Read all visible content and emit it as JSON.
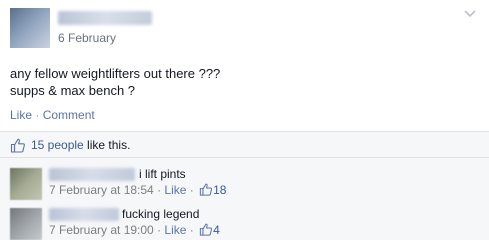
{
  "post": {
    "date": "6 February",
    "body_lines": [
      "any fellow weightlifters out there ???",
      "supps & max bench ?"
    ],
    "actions": {
      "like": "Like",
      "separator": "·",
      "comment": "Comment"
    }
  },
  "feedback": {
    "likes_count": "15 people",
    "likes_suffix": " like this."
  },
  "comments": [
    {
      "text": "i lift pints",
      "date": "7 February at 18:54",
      "separator": " · ",
      "like": "Like",
      "separator2": " · ",
      "likes": "18"
    },
    {
      "text": "fucking legend",
      "date": "7 February at 19:00",
      "separator": " · ",
      "like": "Like",
      "separator2": " · ",
      "likes": "4"
    }
  ],
  "icons": {
    "options": "chevron-down-icon",
    "like": "thumbs-up-icon"
  },
  "colors": {
    "link": "#3b5998",
    "muted_link": "#5b74a8",
    "meta": "#7f7f7f",
    "feedback_bg": "#f6f7f9"
  }
}
